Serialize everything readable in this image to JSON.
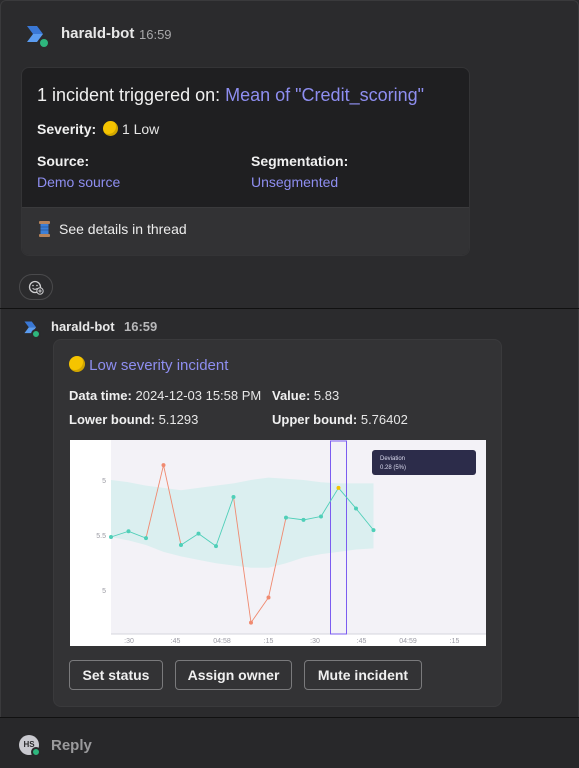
{
  "message1": {
    "author": "harald-bot",
    "time": "16:59",
    "title_prefix": "1 incident triggered on: ",
    "title_link": "Mean of \"Credit_scoring\"",
    "severity_label": "Severity:",
    "severity_value": "1 Low",
    "source_label": "Source:",
    "source_value": "Demo source",
    "segmentation_label": "Segmentation:",
    "segmentation_value": "Unsegmented",
    "thread_text": "See details in thread"
  },
  "message2": {
    "author": "harald-bot",
    "time": "16:59",
    "heading": "Low severity incident",
    "data_time_label": "Data time:",
    "data_time_value": "2024-12-03 15:58 PM",
    "value_label": "Value:",
    "value_value": "5.83",
    "lower_label": "Lower bound:",
    "lower_value": "5.1293",
    "upper_label": "Upper bound:",
    "upper_value": "5.76402",
    "buttons": {
      "set_status": "Set status",
      "assign_owner": "Assign owner",
      "mute_incident": "Mute incident"
    }
  },
  "reply": {
    "avatar_initials": "HS",
    "label": "Reply"
  },
  "colors": {
    "accent_link": "#8e8ef0",
    "online": "#2eb67d",
    "severity_low": "#f5c400",
    "normal_point": "#4fcfb8",
    "anomaly_point": "#f08a70",
    "band": "#d8eeee"
  },
  "chart_data": {
    "type": "line",
    "y_tick_labels": [
      "5",
      "5.5",
      "5"
    ],
    "x_tick_labels": [
      ":30",
      ":45",
      "04:58",
      ":15",
      ":30",
      ":45",
      "04:59",
      ":15",
      ":3"
    ],
    "tooltip_line1": "Deviation",
    "tooltip_line2": "0.28  (5%)",
    "series": [
      {
        "points": [
          {
            "y": 5.45,
            "status": "normal"
          },
          {
            "y": 5.5,
            "status": "normal"
          },
          {
            "y": 5.44,
            "status": "normal"
          },
          {
            "y": 6.08,
            "status": "anomaly"
          },
          {
            "y": 5.38,
            "status": "normal"
          },
          {
            "y": 5.48,
            "status": "normal"
          },
          {
            "y": 5.37,
            "status": "normal"
          },
          {
            "y": 5.8,
            "status": "normal"
          },
          {
            "y": 4.7,
            "status": "anomaly"
          },
          {
            "y": 4.92,
            "status": "anomaly"
          },
          {
            "y": 5.62,
            "status": "normal"
          },
          {
            "y": 5.6,
            "status": "normal"
          },
          {
            "y": 5.63,
            "status": "normal"
          },
          {
            "y": 5.88,
            "status": "highlight"
          },
          {
            "y": 5.7,
            "status": "normal"
          },
          {
            "y": 5.51,
            "status": "normal"
          }
        ]
      }
    ],
    "band_upper": [
      5.95,
      5.93,
      5.9,
      5.88,
      5.86,
      5.88,
      5.9,
      5.92,
      5.95,
      5.97,
      5.96,
      5.95,
      5.93,
      5.92,
      5.92,
      5.92
    ],
    "band_lower": [
      5.45,
      5.42,
      5.38,
      5.32,
      5.28,
      5.25,
      5.22,
      5.2,
      5.18,
      5.18,
      5.22,
      5.27,
      5.3,
      5.32,
      5.34,
      5.35
    ],
    "highlight_index": 13
  }
}
